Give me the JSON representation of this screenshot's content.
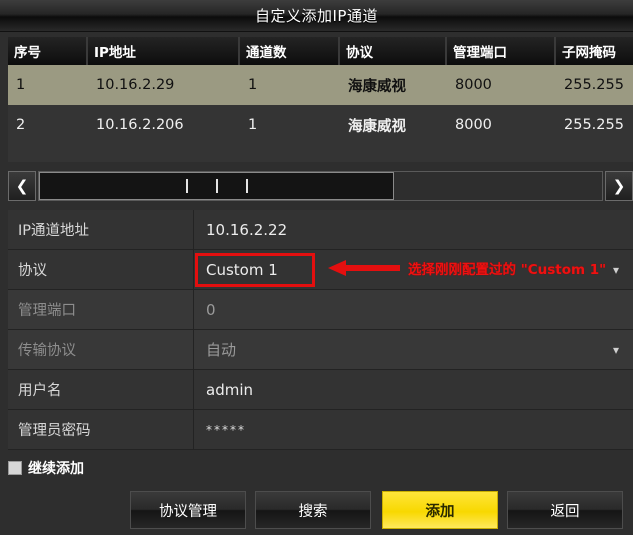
{
  "window": {
    "title": "自定义添加IP通道"
  },
  "device_table": {
    "columns": [
      "序号",
      "IP地址",
      "通道数",
      "协议",
      "管理端口",
      "子网掩码"
    ],
    "rows": [
      {
        "index": "1",
        "ip": "10.16.2.29",
        "channels": "1",
        "protocol": "海康威视",
        "port": "8000",
        "mask": "255.255",
        "selected": true
      },
      {
        "index": "2",
        "ip": "10.16.2.206",
        "channels": "1",
        "protocol": "海康威视",
        "port": "8000",
        "mask": "255.255",
        "selected": false
      }
    ]
  },
  "scrollbar": {
    "left_icon": "chevron-left-icon",
    "right_icon": "chevron-right-icon"
  },
  "form": {
    "fields": [
      {
        "label": "IP通道地址",
        "value": "10.16.2.22",
        "disabled": false,
        "dropdown": false
      },
      {
        "label": "协议",
        "value": "Custom 1",
        "disabled": false,
        "dropdown": true
      },
      {
        "label": "管理端口",
        "value": "0",
        "disabled": true,
        "dropdown": false
      },
      {
        "label": "传输协议",
        "value": "自动",
        "disabled": true,
        "dropdown": true
      },
      {
        "label": "用户名",
        "value": "admin",
        "disabled": false,
        "dropdown": false
      },
      {
        "label": "管理员密码",
        "value": "*****",
        "disabled": false,
        "dropdown": false
      }
    ]
  },
  "annotation": {
    "text": "选择刚刚配置过的 \"Custom 1\"",
    "color": "#ee1111",
    "arrow_icon": "left-arrow-icon"
  },
  "checkbox": {
    "label": "继续添加",
    "checked": false
  },
  "buttons": {
    "protocol_manage": "协议管理",
    "search": "搜索",
    "add": "添加",
    "back": "返回"
  },
  "colors": {
    "selected_row": "#9b9a82",
    "primary_button": "#f8d800",
    "annotation_red": "#e40f0f"
  }
}
